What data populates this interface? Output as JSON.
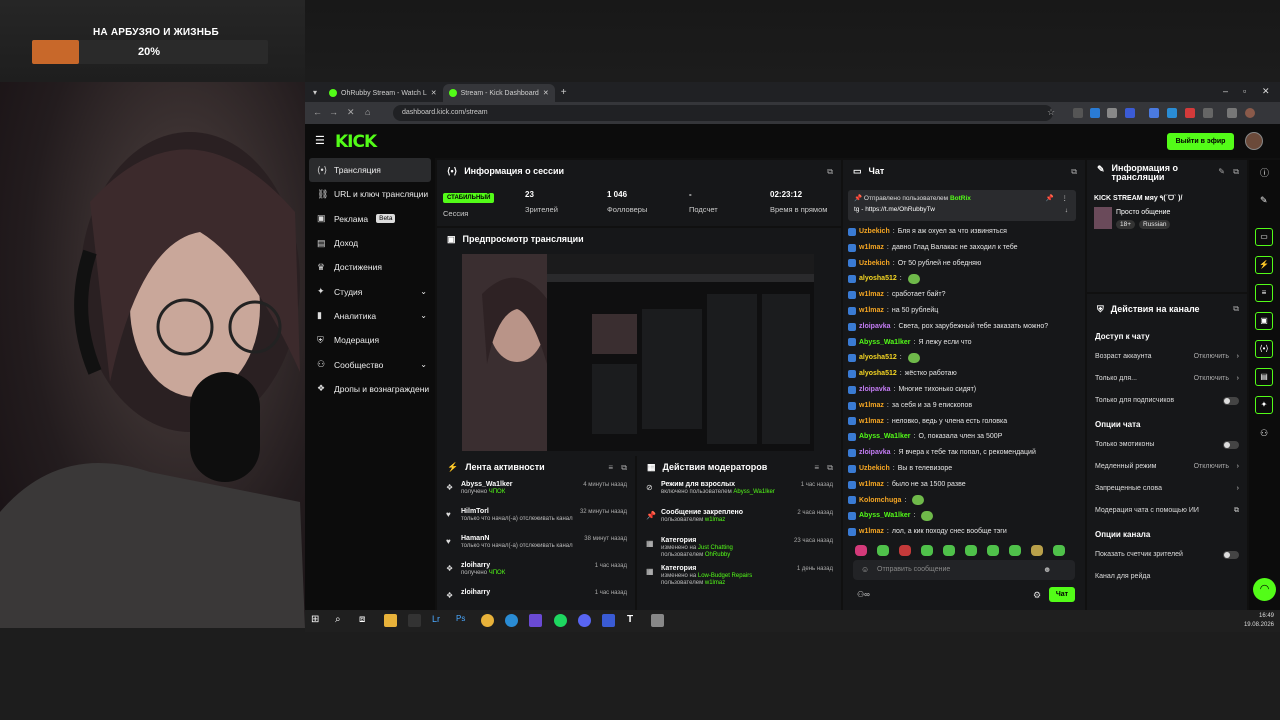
{
  "overlay": {
    "goal_title": "НА АРБУЗЯО И ЖИЗНЬБ",
    "goal_percent": "20%",
    "goal_progress": 0.2
  },
  "browser": {
    "tabs": [
      {
        "label": "OhRubby Stream - Watch L"
      },
      {
        "label": "Stream - Kick Dashboard"
      }
    ],
    "url": "dashboard.kick.com/stream"
  },
  "kick": {
    "logo": "KICK",
    "go_live": "Выйти в эфир"
  },
  "sidebar": {
    "items": [
      {
        "label": "Трансляция",
        "icon": "broadcast-icon"
      },
      {
        "label": "URL и ключ трансляции",
        "icon": "link-icon"
      },
      {
        "label": "Реклама",
        "icon": "ad-icon",
        "badge": "Beta"
      },
      {
        "label": "Доход",
        "icon": "money-icon"
      },
      {
        "label": "Достижения",
        "icon": "trophy-icon"
      },
      {
        "label": "Студия",
        "icon": "studio-icon",
        "chevron": true
      },
      {
        "label": "Аналитика",
        "icon": "chart-icon",
        "chevron": true
      },
      {
        "label": "Модерация",
        "icon": "shield-icon"
      },
      {
        "label": "Сообщество",
        "icon": "community-icon",
        "chevron": true
      },
      {
        "label": "Дропы и вознаграждени",
        "icon": "gift-icon"
      }
    ]
  },
  "session": {
    "title": "Информация о сессии",
    "status": "СТАБИЛЬНЫЙ",
    "status_label": "Сессия",
    "viewers": "23",
    "viewers_label": "Зрителей",
    "followers": "1 046",
    "followers_label": "Фолловеры",
    "subs": "-",
    "subs_label": "Подсчет",
    "time": "02:23:12",
    "time_label": "Время в прямом"
  },
  "preview": {
    "title": "Предпросмотр трансляции"
  },
  "activity": {
    "title": "Лента активности",
    "rows": [
      {
        "name": "Abyss_Wa1lker",
        "sub": "получено",
        "hl": "ЧПОК",
        "time": "4 минуты назад"
      },
      {
        "name": "HilmTorl",
        "sub": "только что начал(-а) отслеживать канал",
        "hl": "",
        "time": "32 минуты назад"
      },
      {
        "name": "HamanN",
        "sub": "только что начал(-а) отслеживать канал",
        "hl": "",
        "time": "38 минут назад"
      },
      {
        "name": "zloiharry",
        "sub": "получено",
        "hl": "ЧПОК",
        "time": "1 час назад"
      },
      {
        "name": "zloiharry",
        "sub": "",
        "hl": "",
        "time": "1 час назад"
      }
    ]
  },
  "modact": {
    "title": "Действия модераторов",
    "rows": [
      {
        "name": "Режим для взрослых",
        "sub": "включено пользователем",
        "hl": "Abyss_Wa1lker",
        "time": "1 час назад"
      },
      {
        "name": "Сообщение закреплено",
        "sub": "пользователем",
        "hl": "w1lmaz",
        "time": "2 часа назад"
      },
      {
        "name": "Категория",
        "sub": "изменено на",
        "hl": "Just Chatting",
        "sub2": "пользователем",
        "hl2": "OhRubby",
        "time": "23 часа назад"
      },
      {
        "name": "Категория",
        "sub": "изменено на",
        "hl": "Low-Budget Repairs",
        "sub2": "пользователем",
        "hl2": "w1lmaz",
        "time": "1 день назад"
      }
    ]
  },
  "chat": {
    "title": "Чат",
    "pinned_by": "Отправлено пользователем",
    "pinned_user": "BotRix",
    "pinned_text": "tg - https://t.me/OhRubbyTw",
    "messages": [
      {
        "user": "Uzbekich",
        "color": "#f5a623",
        "text": "Бля я аж охуел за что извиняться"
      },
      {
        "user": "w1lmaz",
        "color": "#f5a623",
        "text": "давно Глад Валакас не заходил к тебе"
      },
      {
        "user": "Uzbekich",
        "color": "#f5a623",
        "text": "От 50 рублей не обедняю"
      },
      {
        "user": "alyosha512",
        "color": "#f5d623",
        "text": ""
      },
      {
        "user": "w1lmaz",
        "color": "#f5a623",
        "text": "сработает байт?"
      },
      {
        "user": "w1lmaz",
        "color": "#f5a623",
        "text": "на 50 рублейц"
      },
      {
        "user": "zloipavka",
        "color": "#c47cf5",
        "text": "Света, рох зарубежный тебе заказать можно?"
      },
      {
        "user": "Abyss_Wa1lker",
        "color": "#53fc18",
        "text": "Я лежу если что"
      },
      {
        "user": "alyosha512",
        "color": "#f5d623",
        "text": ""
      },
      {
        "user": "alyosha512",
        "color": "#f5d623",
        "text": "жёстко работаю"
      },
      {
        "user": "zloipavka",
        "color": "#c47cf5",
        "text": "Многие тихонько сидят)"
      },
      {
        "user": "w1lmaz",
        "color": "#f5a623",
        "text": "за себя и за 9 епископов"
      },
      {
        "user": "w1lmaz",
        "color": "#f5a623",
        "text": "неловко, ведь у члена есть головка"
      },
      {
        "user": "Abyss_Wa1lker",
        "color": "#53fc18",
        "text": "О, показала член за 500Р"
      },
      {
        "user": "zloipavka",
        "color": "#c47cf5",
        "text": "Я вчера к тебе так попал, с рекомендаций"
      },
      {
        "user": "Uzbekich",
        "color": "#f5a623",
        "text": "Вы в телевизоре"
      },
      {
        "user": "w1lmaz",
        "color": "#f5a623",
        "text": "было не за 1500 разве"
      },
      {
        "user": "Kolomchuga",
        "color": "#f5a623",
        "text": ""
      },
      {
        "user": "Abyss_Wa1lker",
        "color": "#53fc18",
        "text": ""
      },
      {
        "user": "w1lmaz",
        "color": "#f5a623",
        "text": "лол, а кик походу снес вообще тэги"
      }
    ],
    "input_placeholder": "Отправить сообщение",
    "send": "Чат"
  },
  "info": {
    "title": "Информация о трансляции",
    "stream_title": "KICK STREAM мяу ٩(ˊᗜˋ )/",
    "category": "Просто общение",
    "tag1": "18+",
    "tag2": "Russian"
  },
  "actions": {
    "title": "Действия на канале",
    "access": "Доступ к чату",
    "age": "Возраст аккаунта",
    "age_val": "Отключить",
    "only_for": "Только для...",
    "only_for_val": "Отключить",
    "subs_only": "Только для подписчиков",
    "chat_opts": "Опции чата",
    "emotes_only": "Только эмотиконы",
    "slow": "Медленный режим",
    "slow_val": "Отключить",
    "banned": "Запрещенные слова",
    "ai_mod": "Модерация чата с помощью ИИ",
    "channel_opts": "Опции канала",
    "show_viewers": "Показать счетчик зрителей",
    "raid": "Канал для рейда"
  },
  "taskbar": {
    "time": "16:49",
    "date": "19.08.2026"
  },
  "colors": {
    "accent": "#53fc18",
    "bg": "#0c0c0c",
    "panel": "#161719"
  }
}
